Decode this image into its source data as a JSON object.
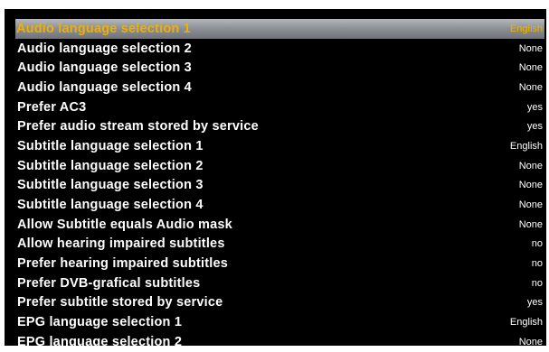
{
  "colors": {
    "background": "#000000",
    "text": "#ffffff",
    "selected_text": "#f0b000",
    "selected_bar": "#8e9296"
  },
  "settings": [
    {
      "label": "Audio language selection 1",
      "value": "English",
      "selected": true
    },
    {
      "label": "Audio language selection 2",
      "value": "None"
    },
    {
      "label": "Audio language selection 3",
      "value": "None"
    },
    {
      "label": "Audio language selection 4",
      "value": "None"
    },
    {
      "label": "Prefer AC3",
      "value": "yes"
    },
    {
      "label": "Prefer audio stream stored by service",
      "value": "yes"
    },
    {
      "label": "Subtitle language selection 1",
      "value": "English"
    },
    {
      "label": "Subtitle language selection 2",
      "value": "None"
    },
    {
      "label": "Subtitle language selection 3",
      "value": "None"
    },
    {
      "label": "Subtitle language selection 4",
      "value": "None"
    },
    {
      "label": "Allow Subtitle equals Audio mask",
      "value": "None"
    },
    {
      "label": "Allow hearing impaired subtitles",
      "value": "no"
    },
    {
      "label": "Prefer hearing impaired subtitles",
      "value": "no"
    },
    {
      "label": "Prefer DVB-grafical subtitles",
      "value": "no"
    },
    {
      "label": "Prefer subtitle stored by service",
      "value": "yes"
    },
    {
      "label": "EPG language selection 1",
      "value": "English"
    },
    {
      "label": "EPG language selection 2",
      "value": "None"
    }
  ]
}
